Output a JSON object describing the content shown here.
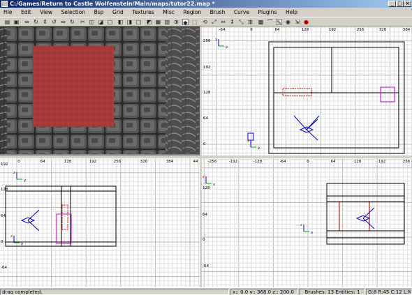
{
  "window": {
    "title": "C:/Games/Return to Castle Wolfenstein/Main/maps/tutor22.map *",
    "minimize": "_",
    "maximize": "□",
    "close": "×"
  },
  "menu": [
    "File",
    "Edit",
    "View",
    "Selection",
    "Bsp",
    "Grid",
    "Textures",
    "Misc",
    "Region",
    "Brush",
    "Curve",
    "Plugins",
    "Help"
  ],
  "toolbar_icons": [
    "open-icon",
    "save-icon",
    "x-axis-flip-icon",
    "x-axis-rotate-icon",
    "y-axis-flip-icon",
    "y-axis-rotate-icon",
    "z-axis-flip-icon",
    "z-axis-rotate-icon",
    "clipper-icon",
    "select-touching-icon",
    "select-partial-icon",
    "select-inside-icon",
    "csg-subtract-icon",
    "csg-merge-icon",
    "hollow-icon",
    "change-view-icon",
    "texture-view-icon",
    "cubic-clip-icon",
    "camera-move-icon",
    "show-entities-icon",
    "show-models-icon",
    "free-rotate-icon",
    "free-scale-icon",
    "scale-x-icon",
    "scale-y-icon",
    "scale-z-icon",
    "texture-lock-icon",
    "patch-icon",
    "bend-icon",
    "entity-icon",
    "eye-icon",
    "texture-fit-icon",
    "lock-icon"
  ],
  "views": {
    "xy": {
      "top_labels": [
        "-64",
        "0",
        "64",
        "128",
        "192",
        "256",
        "320",
        "384"
      ],
      "left_labels": [
        "256",
        "192",
        "128",
        "64",
        "0"
      ],
      "axis_x": "x",
      "axis_y": "y"
    },
    "yz": {
      "top_labels": [
        "0",
        "64",
        "128",
        "192",
        "256",
        "320",
        "384",
        "44"
      ],
      "left_labels": [
        "192",
        "128",
        "64",
        "0",
        "-64"
      ],
      "axis_h": "y",
      "axis_v": "z"
    },
    "xz": {
      "top_labels": [
        "-256",
        "-192",
        "-128",
        "-64",
        "0",
        "64",
        "128",
        "192",
        "256"
      ],
      "left_labels": [
        "128",
        "64",
        "0",
        "-64"
      ],
      "axis_h": "x",
      "axis_v": "z"
    }
  },
  "status": {
    "message": "drag completed.",
    "coords": "x:: 0.0  y:: 368.0  z:: 200.0",
    "brushes": "Brushes: 13 Entities: 1",
    "grid": "G:8 R:45 C:12 L:MR"
  },
  "colors": {
    "grid_bg": "#ffffff",
    "grid_minor": "#e0e0e0",
    "grid_major": "#b8b8b8",
    "brush": "#000000",
    "selected": "#c00000",
    "camera": "#0000e0",
    "entity": "#d000d0",
    "texture_red": "#a83a3a"
  }
}
